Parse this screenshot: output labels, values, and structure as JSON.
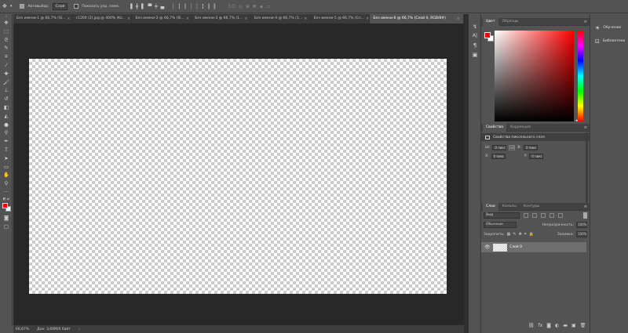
{
  "options_bar": {
    "autoselect_label": "Автовыбор:",
    "autoselect_value": "Слой",
    "transform_label": "Показать упр. элем."
  },
  "tabs": [
    {
      "label": "Без имени-1 @ 66,7% (Sl..."
    },
    {
      "label": "c1200 (2).jpg @ 400% (Ko..."
    },
    {
      "label": "Без имени-2 @ 66,7% (Sl..."
    },
    {
      "label": "Без имени-3 @ 66,7% (1..."
    },
    {
      "label": "Без имени-4 @ 66,7% (1..."
    },
    {
      "label": "Без имени-5 @ 66,7% (Cл..."
    },
    {
      "label": "Без имени-6 @ 66,7% (Слой 0, RGB/8#)"
    }
  ],
  "status": {
    "zoom": "66,67%",
    "doc_info": "Док: 3,60M/0 байт"
  },
  "color_panel": {
    "tab_color": "Цвет",
    "tab_swatches": "Образцы",
    "fg_color": "#ff0000",
    "bg_color": "#ffffff"
  },
  "properties_panel": {
    "tab_properties": "Свойства",
    "tab_corrections": "Коррекция",
    "header": "Свойства пиксельного слоя",
    "w_label": "Ш:",
    "w_value": "0 пикс",
    "h_label": "В:",
    "h_value": "0 пикс",
    "x_label": "X:",
    "x_value": "0 пикс",
    "y_label": "Y:",
    "y_value": "0 пикс",
    "link_label": "GO"
  },
  "layers_panel": {
    "tab_layers": "Слои",
    "tab_channels": "Каналы",
    "tab_paths": "Контуры",
    "filter_value": "Вид",
    "blend_mode": "Обычные",
    "opacity_label": "Непрозрачность:",
    "opacity_value": "100%",
    "lock_label": "Закрепить:",
    "fill_label": "Заливка:",
    "fill_value": "100%",
    "layers": [
      {
        "name": "Слой 0",
        "visible": true
      }
    ]
  },
  "right_dock": {
    "learn_label": "Обучение",
    "libraries_label": "Библиотеки"
  }
}
